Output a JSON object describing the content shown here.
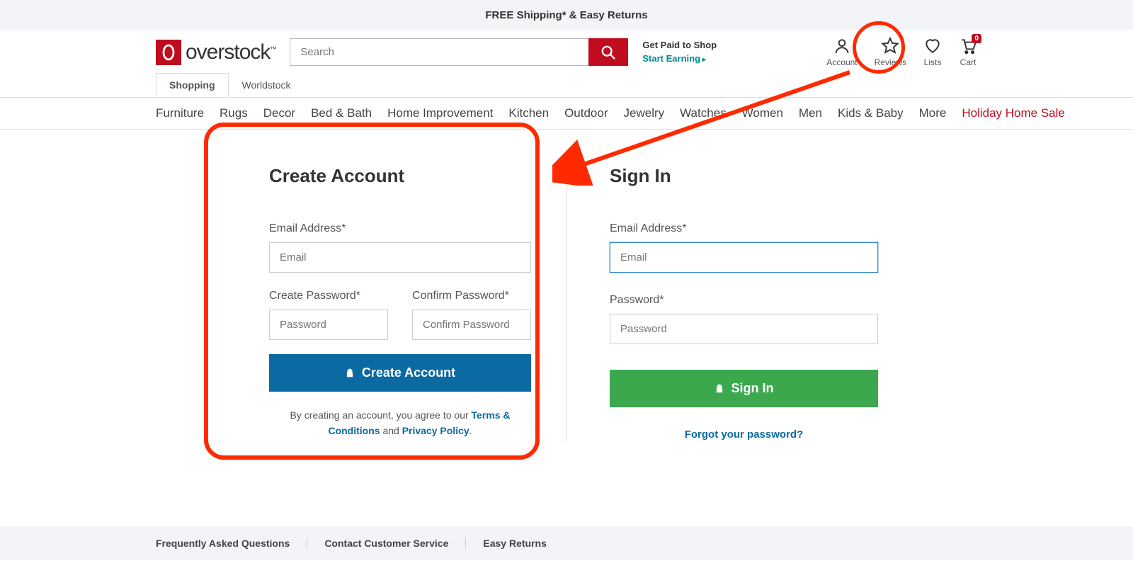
{
  "promo": {
    "text": "FREE Shipping* & Easy Returns"
  },
  "logo": {
    "text": "overstock",
    "tm": "™"
  },
  "search": {
    "placeholder": "Search"
  },
  "paidShop": {
    "l1": "Get Paid to Shop",
    "l2": "Start Earning"
  },
  "headIcons": {
    "account": "Account",
    "reviews": "Reviews",
    "lists": "Lists",
    "cart": "Cart",
    "cartCount": "0"
  },
  "tabs": {
    "shopping": "Shopping",
    "worldstock": "Worldstock"
  },
  "cats": [
    "Furniture",
    "Rugs",
    "Decor",
    "Bed & Bath",
    "Home Improvement",
    "Kitchen",
    "Outdoor",
    "Jewelry",
    "Watches",
    "Women",
    "Men",
    "Kids & Baby",
    "More",
    "Holiday Home Sale"
  ],
  "create": {
    "title": "Create Account",
    "emailLabel": "Email Address*",
    "emailPlaceholder": "Email",
    "pwLabel": "Create Password*",
    "pwPlaceholder": "Password",
    "confirmLabel": "Confirm Password*",
    "confirmPlaceholder": "Confirm Password",
    "button": "Create Account",
    "terms": {
      "pre": "By creating an account, you agree to our ",
      "tc": "Terms & Conditions",
      "and": " and ",
      "pp": "Privacy Policy",
      "dot": "."
    }
  },
  "signin": {
    "title": "Sign In",
    "emailLabel": "Email Address*",
    "emailPlaceholder": "Email",
    "pwLabel": "Password*",
    "pwPlaceholder": "Password",
    "button": "Sign In",
    "forgot": "Forgot your password?"
  },
  "footer": [
    "Frequently Asked Questions",
    "Contact Customer Service",
    "Easy Returns"
  ]
}
